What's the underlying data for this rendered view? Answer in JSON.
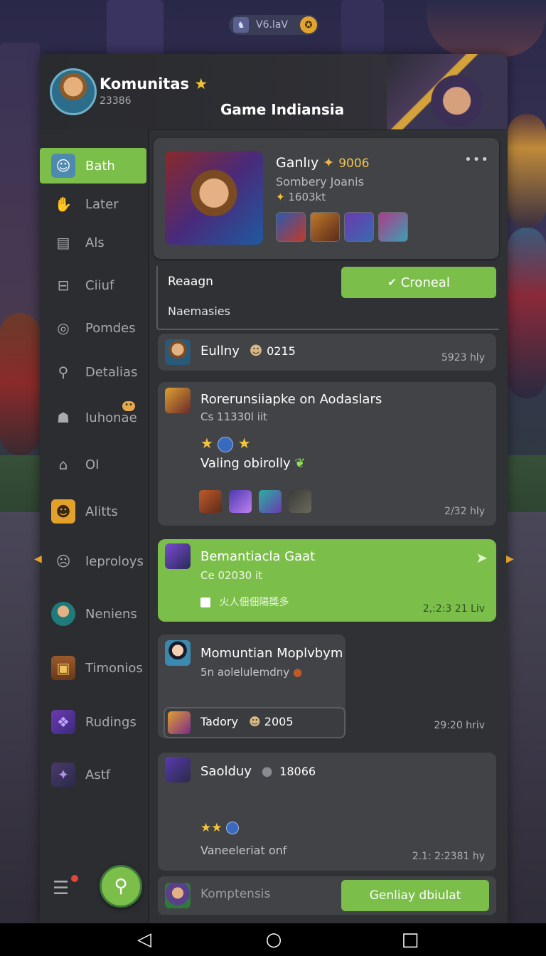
{
  "status_pill": {
    "text": "V6.laV",
    "coin_glyph": "✪"
  },
  "header": {
    "community_name": "Komunitas",
    "community_sub": "23386",
    "title": "Game Indiansia"
  },
  "sidebar": {
    "items": [
      {
        "label": "Bath",
        "icon": "gamer-avatar-icon",
        "glyph": "☺",
        "active": true
      },
      {
        "label": "Later",
        "icon": "thumbs-up-icon",
        "glyph": "👍"
      },
      {
        "label": "Als",
        "icon": "document-icon",
        "glyph": "▤"
      },
      {
        "label": "Ciiuf",
        "icon": "ticket-icon",
        "glyph": "⊟"
      },
      {
        "label": "Pomdes",
        "icon": "target-icon",
        "glyph": "◎"
      },
      {
        "label": "Detalias",
        "icon": "location-pin-icon",
        "glyph": "⬤"
      },
      {
        "label": "Iuhonae",
        "icon": "group-icon",
        "glyph": "☗",
        "badge": "••"
      },
      {
        "label": "OI",
        "icon": "home-icon",
        "glyph": "⌂"
      },
      {
        "label": "Alitts",
        "icon": "mask-icon",
        "glyph": "☻"
      },
      {
        "label": "Ieproloys",
        "icon": "gamepad-icon",
        "glyph": "☹"
      },
      {
        "label": "Neniens",
        "icon": "hero-avatar-icon",
        "glyph": "☺"
      },
      {
        "label": "Timonios",
        "icon": "treasure-chest-icon",
        "glyph": "▣"
      },
      {
        "label": "Rudings",
        "icon": "dragon-icon",
        "glyph": "❖"
      },
      {
        "label": "Astf",
        "icon": "wizard-icon",
        "glyph": "✦"
      }
    ],
    "bottom_icon": "list-notification-icon",
    "fab_icon": "search-icon",
    "fab_glyph": "⚲"
  },
  "profile_card": {
    "name": "Ganlıy",
    "coin_value": "9006",
    "subtitle": "Sombery Joanis",
    "points": "1603kt",
    "more_glyph": "•••"
  },
  "form": {
    "label_region": "Reaagn",
    "label_name": "Naemasies",
    "connect_button": "Croneal"
  },
  "messages": [
    {
      "name": "Eullny",
      "badge": "0215",
      "time": "5923 hly"
    },
    {
      "title": "Rorerunsiiapke on Aodaslars",
      "sub": "Cs 11330l iit",
      "text": "Valing obirolly",
      "time": "2/32 hly"
    },
    {
      "title": "Bemantiacla Gaat",
      "sub": "Ce 02030 it",
      "text": "火人佃佃陽獎多",
      "time": "2,:2:3 21 Liv"
    },
    {
      "title": "Momuntian Moplvbym",
      "sub": "5n aolelulemdny",
      "card_name": "Tadory",
      "card_value": "2005",
      "time": "29:20 hriv"
    },
    {
      "title": "Saolduy",
      "badge": "18066",
      "text": "Vaneeleriat onf",
      "time": "2.1: 2:2381 hy"
    }
  ],
  "composer": {
    "placeholder": "Komptensis",
    "button": "Genliay dbiulat"
  },
  "navbar": {
    "back": "◁",
    "home": "○",
    "recent": "□"
  },
  "colors": {
    "accent": "#7bbf4a",
    "panel": "#424347",
    "sidebar": "#2c2d30",
    "gold": "#f3c43b"
  }
}
